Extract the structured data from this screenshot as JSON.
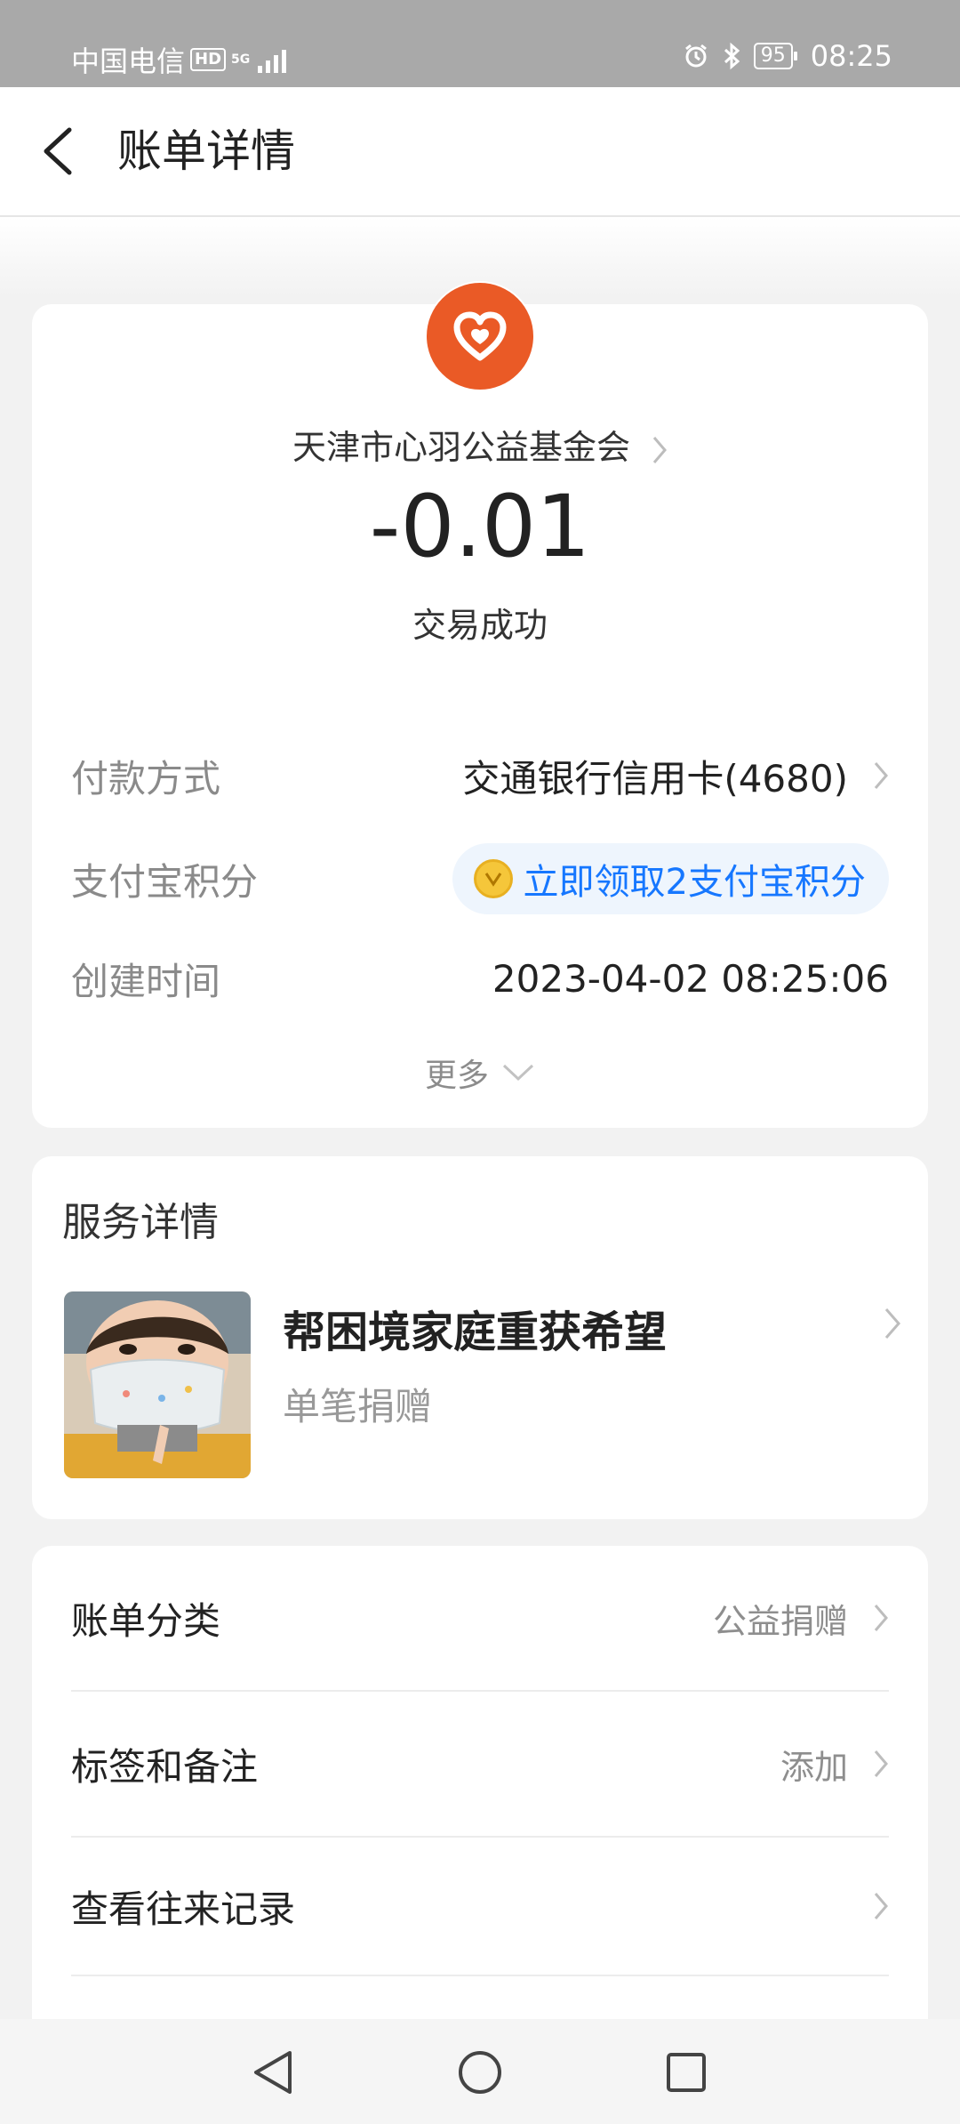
{
  "status_bar": {
    "carrier": "中国电信",
    "hd": "HD",
    "network": "5G",
    "battery": "95",
    "time": "08:25"
  },
  "nav": {
    "title": "账单详情"
  },
  "transaction": {
    "merchant": "天津市心羽公益基金会",
    "amount": "-0.01",
    "status": "交易成功",
    "payment_method_label": "付款方式",
    "payment_method_value": "交通银行信用卡(4680)",
    "points_label": "支付宝积分",
    "points_value": "立即领取2支付宝积分",
    "created_label": "创建时间",
    "created_value": "2023-04-02 08:25:06",
    "more_label": "更多"
  },
  "service": {
    "title": "服务详情",
    "project_name": "帮困境家庭重获希望",
    "project_type": "单笔捐赠"
  },
  "list": [
    {
      "label": "账单分类",
      "value": "公益捐赠"
    },
    {
      "label": "标签和备注",
      "value": "添加"
    },
    {
      "label": "查看往来记录",
      "value": ""
    }
  ],
  "colors": {
    "accent": "#1677ff",
    "logo": "#ea5a26",
    "status_bar": "#a9a9a9"
  }
}
